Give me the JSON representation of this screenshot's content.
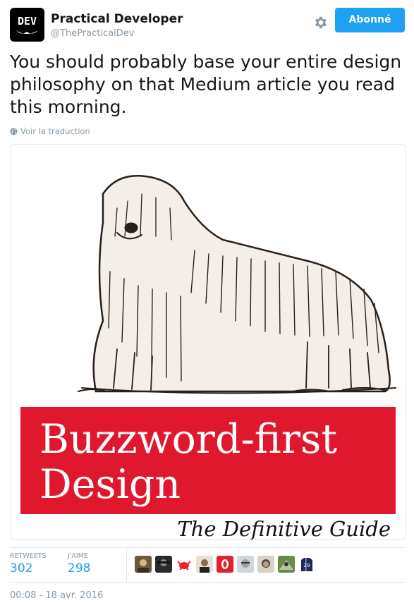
{
  "account": {
    "logo_text": "DEV",
    "name": "Practical Developer",
    "handle": "@ThePracticalDev"
  },
  "actions": {
    "follow_label": "Abonné",
    "settings_icon": "gear-icon"
  },
  "tweet": {
    "text": "You should probably base your entire design philosophy on that Medium article you read this morning.",
    "translate_label": "Voir la traduction",
    "translate_icon": "globe-icon"
  },
  "media": {
    "banner_title_line1": "Buzzword-first",
    "banner_title_line2": "Design",
    "subtitle": "The Definitive Guide"
  },
  "stats": {
    "retweets_label": "RETWEETS",
    "retweets_count": "302",
    "likes_label": "J'AIME",
    "likes_count": "298"
  },
  "likers": [
    {
      "color": "#6b5a3a"
    },
    {
      "color": "#2a2a2a"
    },
    {
      "color": "#e8242d"
    },
    {
      "color": "#8a6a4a"
    },
    {
      "color": "#e0202a"
    },
    {
      "color": "#9aa3ab"
    },
    {
      "color": "#4b4b4b"
    },
    {
      "color": "#6a8a4a"
    },
    {
      "color": "#1e2a5a"
    }
  ],
  "timestamp": "00:08 - 18 avr. 2016",
  "colors": {
    "accent": "#1da1f2",
    "muted": "#8899a6",
    "banner_red": "#e0182d"
  }
}
